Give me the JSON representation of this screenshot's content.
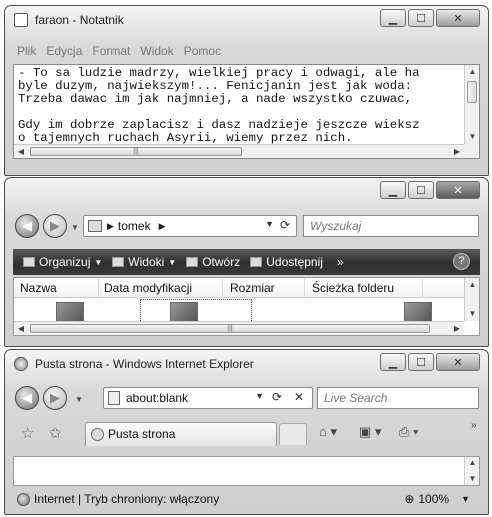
{
  "notepad": {
    "title": "faraon - Notatnik",
    "menu": [
      "Plik",
      "Edycja",
      "Format",
      "Widok",
      "Pomoc"
    ],
    "lines": [
      "- To sa ludzie madrzy, wielkiej pracy i odwagi, ale ha",
      "byle duzym, najwiekszym!... Fenicjanin jest jak woda:",
      "Trzeba dawac im jak najmniej, a nade wszystko czuwac,",
      "",
      "Gdy im dobrze zaplacisz i dasz nadzieje jeszcze wieksz",
      "o tajemnych ruchach Asyrii, wiemy przez nich."
    ]
  },
  "explorer": {
    "breadcrumb": "tomek",
    "search_placeholder": "Wyszukaj",
    "commands": [
      {
        "label": "Organizuj",
        "icon": "organize-icon"
      },
      {
        "label": "Widoki",
        "icon": "views-icon"
      },
      {
        "label": "Otwórz",
        "icon": "open-icon"
      },
      {
        "label": "Udostępnij",
        "icon": "share-icon"
      }
    ],
    "more": "»",
    "help": "?",
    "columns": [
      "Nazwa",
      "Data modyfikacji",
      "Rozmiar",
      "Ścieżka folderu"
    ]
  },
  "ie": {
    "title": "Pusta strona - Windows Internet Explorer",
    "address": "about:blank",
    "search_placeholder": "Live Search",
    "tab_label": "Pusta strona",
    "status": "Internet | Tryb chroniony: włączony",
    "zoom": "100%",
    "more": "»"
  }
}
